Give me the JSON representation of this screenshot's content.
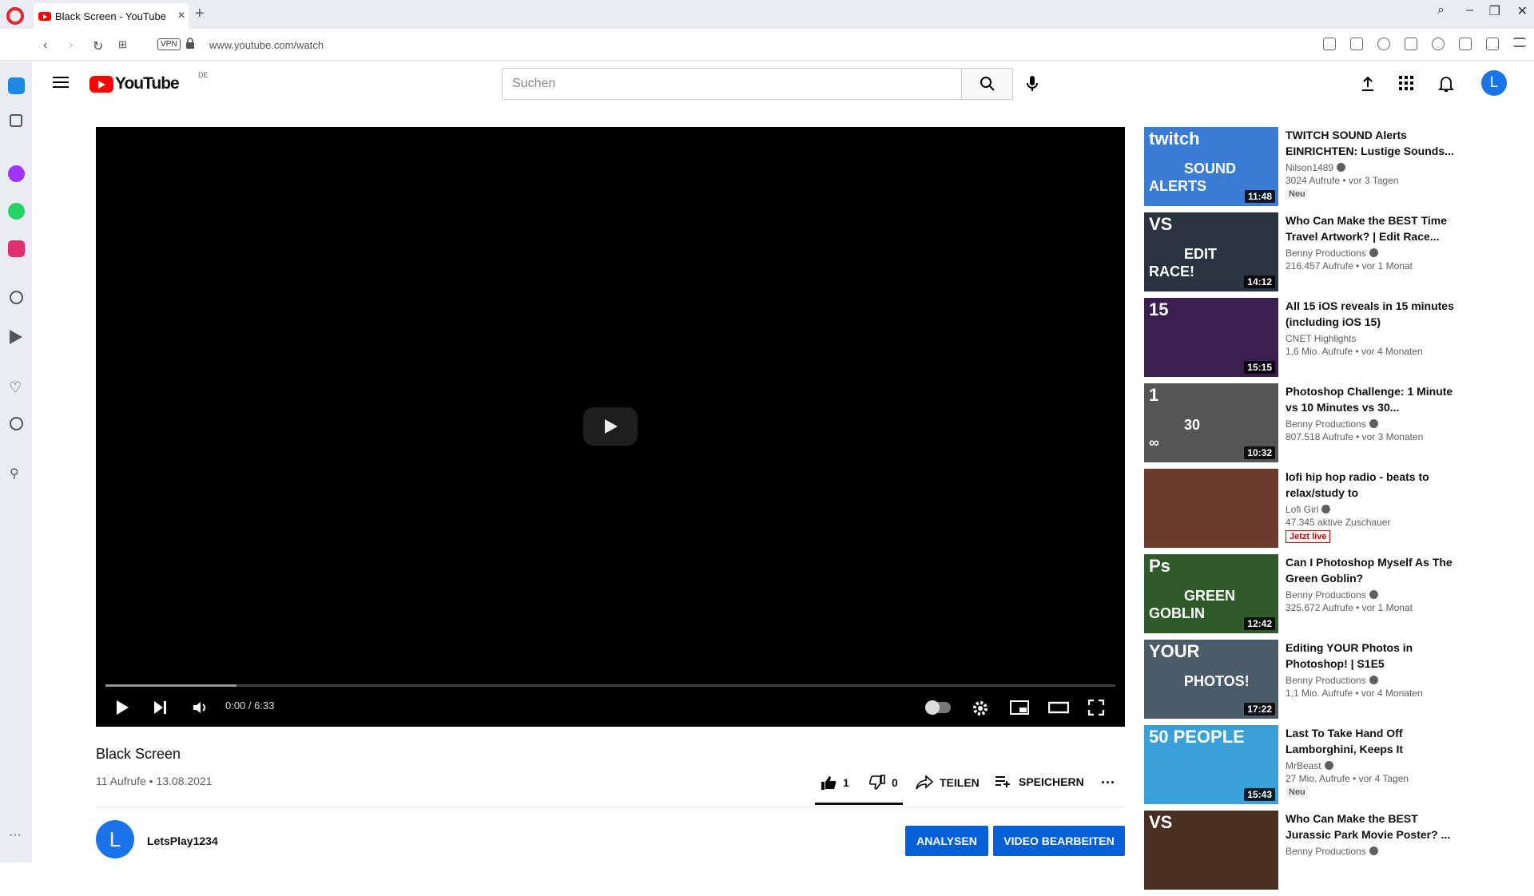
{
  "browser": {
    "tab_title": "Black Screen - YouTube",
    "url": "www.youtube.com/watch",
    "vpn_label": "VPN"
  },
  "youtube": {
    "logo_text": "YouTube",
    "country_code": "DE",
    "search_placeholder": "Suchen",
    "avatar_letter": "L"
  },
  "player": {
    "time": "0:00 / 6:33",
    "progress_fraction": 0.0,
    "buffered_fraction": 0.13
  },
  "video": {
    "title": "Black Screen",
    "meta": "11 Aufrufe • 13.08.2021",
    "likes": "1",
    "dislikes": "0",
    "share_label": "TEILEN",
    "save_label": "SPEICHERN",
    "channel_avatar": "L",
    "channel_name": "LetsPlay1234",
    "analyze_label": "ANALYSEN",
    "edit_label": "VIDEO BEARBEITEN"
  },
  "recommendations": [
    {
      "title": "TWITCH SOUND Alerts EINRICHTEN: Lustige Sounds...",
      "channel": "Nilson1489",
      "meta": "3024 Aufrufe • vor 3 Tagen",
      "badge": "Neu",
      "duration": "11:48",
      "thumb_bg": "#3a7bd5",
      "thumb_text": [
        "twitch",
        "SOUND",
        "ALERTS"
      ]
    },
    {
      "title": "Who Can Make the BEST Time Travel Artwork? | Edit Race...",
      "channel": "Benny Productions",
      "meta": "216.457 Aufrufe • vor 1 Monat",
      "badge": "",
      "duration": "14:12",
      "thumb_bg": "#2a3340",
      "thumb_text": [
        "VS",
        "EDIT",
        "RACE!"
      ]
    },
    {
      "title": "All 15 iOS reveals in 15 minutes (including iOS 15)",
      "channel": "CNET Highlights",
      "meta": "1,6 Mio. Aufrufe • vor 4 Monaten",
      "badge": "",
      "duration": "15:15",
      "thumb_bg": "#3b1d4f",
      "thumb_text": [
        "15"
      ]
    },
    {
      "title": "Photoshop Challenge: 1 Minute vs 10 Minutes vs 30...",
      "channel": "Benny Productions",
      "meta": "807.518 Aufrufe • vor 3 Monaten",
      "badge": "",
      "duration": "10:32",
      "thumb_bg": "#555555",
      "thumb_text": [
        "1",
        "30",
        "∞"
      ]
    },
    {
      "title": "lofi hip hop radio - beats to relax/study to",
      "channel": "Lofi Girl",
      "meta": "47.345 aktive Zuschauer",
      "badge": "Jetzt live",
      "duration": "",
      "thumb_bg": "#6b3b2e",
      "thumb_text": []
    },
    {
      "title": "Can I Photoshop Myself As The Green Goblin?",
      "channel": "Benny Productions",
      "meta": "325.672 Aufrufe • vor 1 Monat",
      "badge": "",
      "duration": "12:42",
      "thumb_bg": "#2f5a2a",
      "thumb_text": [
        "Ps",
        "GREEN",
        "GOBLIN"
      ]
    },
    {
      "title": "Editing YOUR Photos in Photoshop! | S1E5",
      "channel": "Benny Productions",
      "meta": "1,1 Mio. Aufrufe • vor 4 Monaten",
      "badge": "",
      "duration": "17:22",
      "thumb_bg": "#4a5c6a",
      "thumb_text": [
        "YOUR",
        "PHOTOS!"
      ]
    },
    {
      "title": "Last To Take Hand Off Lamborghini, Keeps It",
      "channel": "MrBeast",
      "meta": "27 Mio. Aufrufe • vor 4 Tagen",
      "badge": "Neu",
      "duration": "15:43",
      "thumb_bg": "#3aa0d8",
      "thumb_text": [
        "50 PEOPLE"
      ]
    },
    {
      "title": "Who Can Make the BEST Jurassic Park Movie Poster? ...",
      "channel": "Benny Productions",
      "meta": "",
      "badge": "",
      "duration": "",
      "thumb_bg": "#4a3020",
      "thumb_text": [
        "VS"
      ]
    }
  ]
}
